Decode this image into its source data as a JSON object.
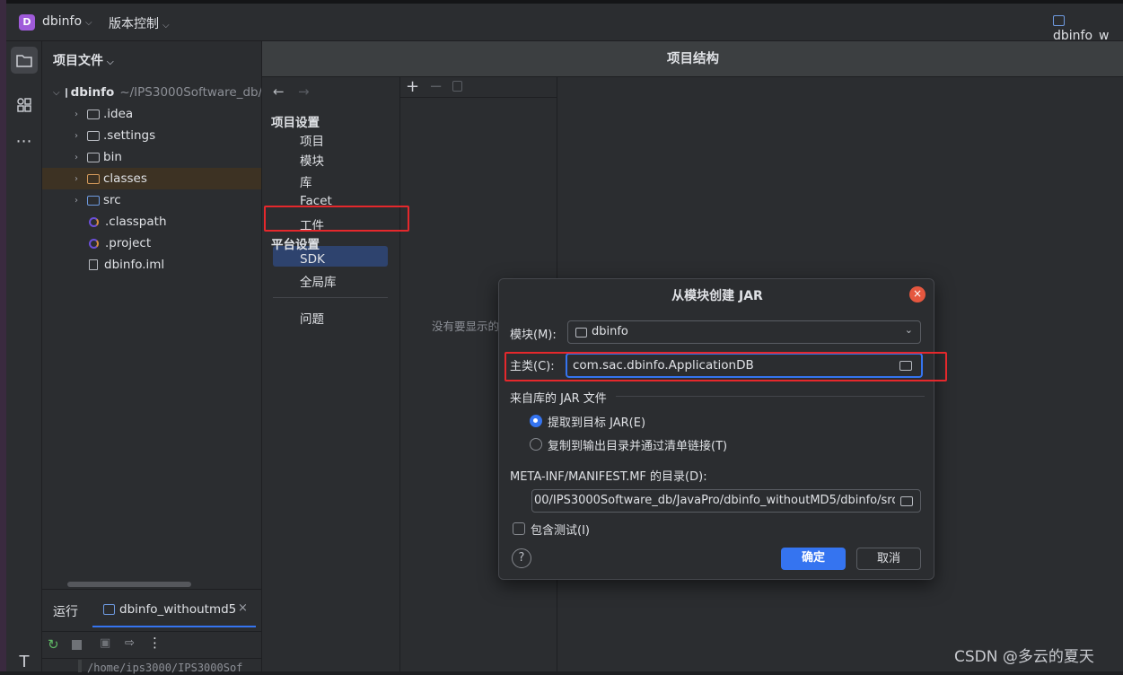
{
  "topbar": {
    "project_badge": "D",
    "project_name": "dbinfo",
    "vcs_label": "版本控制",
    "run_config": "dbinfo_w"
  },
  "project_panel": {
    "title": "项目文件",
    "root": {
      "name": "dbinfo",
      "path": "~/IPS3000Software_db/"
    },
    "items": [
      {
        "label": ".idea",
        "kind": "folder"
      },
      {
        "label": ".settings",
        "kind": "folder"
      },
      {
        "label": "bin",
        "kind": "folder"
      },
      {
        "label": "classes",
        "kind": "folder-orange"
      },
      {
        "label": "src",
        "kind": "folder-blue"
      },
      {
        "label": ".classpath",
        "kind": "file"
      },
      {
        "label": ".project",
        "kind": "file"
      },
      {
        "label": "dbinfo.iml",
        "kind": "file"
      }
    ]
  },
  "run_panel": {
    "title": "运行",
    "tab": "dbinfo_withoutmd5",
    "path_text": "/home/ips3000/IPS3000Sof"
  },
  "project_structure": {
    "title": "项目结构",
    "project_settings": "项目设置",
    "nav": [
      "项目",
      "模块",
      "库",
      "Facet",
      "工件"
    ],
    "platform_settings": "平台设置",
    "platform_nav": [
      "SDK",
      "全局库"
    ],
    "problems": "问题",
    "empty_text": "没有要显示的"
  },
  "jar_dialog": {
    "title": "从模块创建 JAR",
    "module_label": "模块(M):",
    "module_value": "dbinfo",
    "main_class_label": "主类(C):",
    "main_class_value": "com.sac.dbinfo.ApplicationDB",
    "jar_section": "来自库的 JAR 文件",
    "radio_extract": "提取到目标 JAR(E)",
    "radio_copy": "复制到输出目录并通过清单链接(T)",
    "manifest_label": "META-INF/MANIFEST.MF 的目录(D):",
    "manifest_value": "00/IPS3000Software_db/JavaPro/dbinfo_withoutMD5/dbinfo/src",
    "include_tests": "包含测试(I)",
    "ok": "确定",
    "cancel": "取消",
    "help": "?"
  },
  "watermark": "CSDN @多云的夏天",
  "colors": {
    "accent": "#3574f0",
    "highlight_box": "#e5282c",
    "selection": "#2e436e"
  }
}
